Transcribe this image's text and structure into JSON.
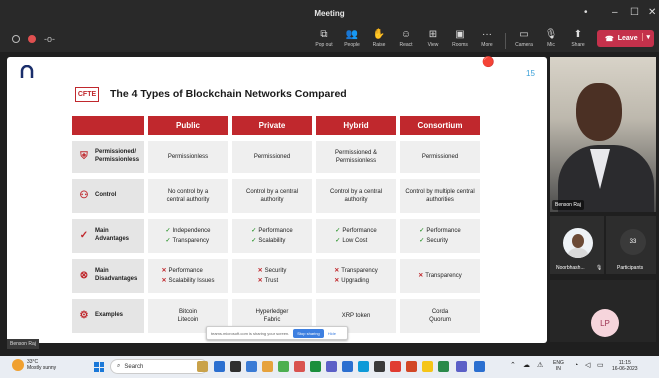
{
  "window": {
    "title": "Meeting",
    "controls": [
      "–",
      "☐",
      "✕"
    ]
  },
  "toolbar": {
    "items": [
      {
        "label": "Pop out",
        "icon": "popout-icon"
      },
      {
        "label": "People",
        "icon": "people-icon"
      },
      {
        "label": "Raise",
        "icon": "hand-icon"
      },
      {
        "label": "React",
        "icon": "smile-icon"
      },
      {
        "label": "View",
        "icon": "grid-icon"
      },
      {
        "label": "Rooms",
        "icon": "rooms-icon"
      },
      {
        "label": "More",
        "icon": "more-icon"
      },
      {
        "label": "Camera",
        "icon": "camera-icon"
      },
      {
        "label": "Mic",
        "icon": "mic-icon"
      },
      {
        "label": "Share",
        "icon": "share-icon"
      }
    ],
    "leave_label": "Leave"
  },
  "slide": {
    "page_number": "15",
    "logo_text": "CFTE",
    "title": "The 4 Types of Blockchain Networks Compared",
    "columns": [
      "Public",
      "Private",
      "Hybrid",
      "Consortium"
    ],
    "rows": [
      {
        "label": "Permissioned/ Permissionless",
        "cells": [
          "Permissionless",
          "Permissioned",
          "Permissioned & Permissionless",
          "Permissioned"
        ]
      },
      {
        "label": "Control",
        "cells": [
          "No control by a central authority",
          "Control by a central authority",
          "Control by a central authority",
          "Control by multiple central authorities"
        ]
      },
      {
        "label": "Main Advantages",
        "lists": [
          [
            "Independence",
            "Transparency"
          ],
          [
            "Performance",
            "Scalability"
          ],
          [
            "Performance",
            "Low Cost"
          ],
          [
            "Performance",
            "Security"
          ]
        ]
      },
      {
        "label": "Main Disadvantages",
        "lists": [
          [
            "Performance",
            "Scalability Issues"
          ],
          [
            "Security",
            "Trust"
          ],
          [
            "Transparency",
            "Upgrading"
          ],
          [
            "Transparency"
          ]
        ]
      },
      {
        "label": "Examples",
        "lists": [
          [
            "Bitcoin",
            "Litecoin"
          ],
          [
            "Hyperledger",
            "Fabric"
          ],
          [
            "XRP token"
          ],
          [
            "Corda",
            "Quorum"
          ]
        ]
      }
    ]
  },
  "share_bar": {
    "text": "teams.microsoft.com is sharing your screen.",
    "stop_label": "Stop sharing",
    "hide_label": "Hide"
  },
  "participants": {
    "speaker_name": "Benson Raj",
    "tile_name": "Noorbhash...",
    "count": "33",
    "count_label": "Participants",
    "self_initials": "LP",
    "self_name": "Benson Raj"
  },
  "taskbar": {
    "weather_temp": "33°C",
    "weather_desc": "Mostly sunny",
    "search_placeholder": "Search",
    "lang": "ENG",
    "region": "IN",
    "time": "11:15",
    "date": "16-06-2023"
  },
  "colors": {
    "accent": "#c0282d",
    "leave": "#c4314b",
    "taskbar": "#e9edf3"
  }
}
